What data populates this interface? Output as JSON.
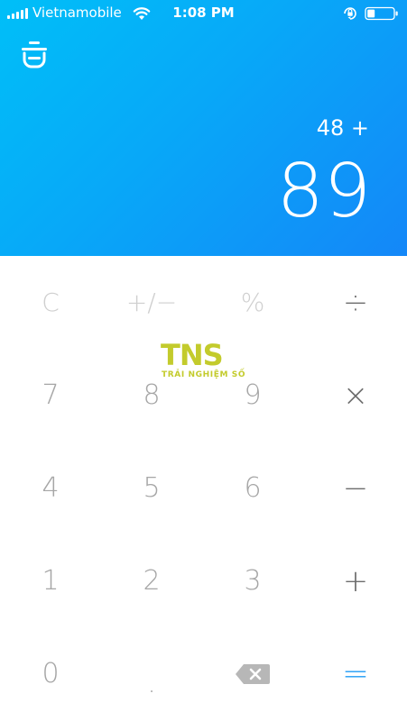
{
  "status_bar": {
    "carrier": "Vietnamobile",
    "time": "1:08 PM"
  },
  "display": {
    "expression": "48 +",
    "result": "89"
  },
  "keys": {
    "clear": "C",
    "sign": "+/−",
    "percent": "%",
    "divide": "÷",
    "seven": "7",
    "eight": "8",
    "nine": "9",
    "multiply": "×",
    "four": "4",
    "five": "5",
    "six": "6",
    "minus": "−",
    "one": "1",
    "two": "2",
    "three": "3",
    "plus": "+",
    "zero": "0",
    "decimal": ".",
    "equals": "="
  },
  "watermark": {
    "logo": "TNS",
    "subtitle": "TRẢI NGHIỆM SỐ"
  },
  "colors": {
    "accent": "#1e9bf5",
    "gradient_start": "#00bff8",
    "gradient_end": "#1487f8"
  }
}
